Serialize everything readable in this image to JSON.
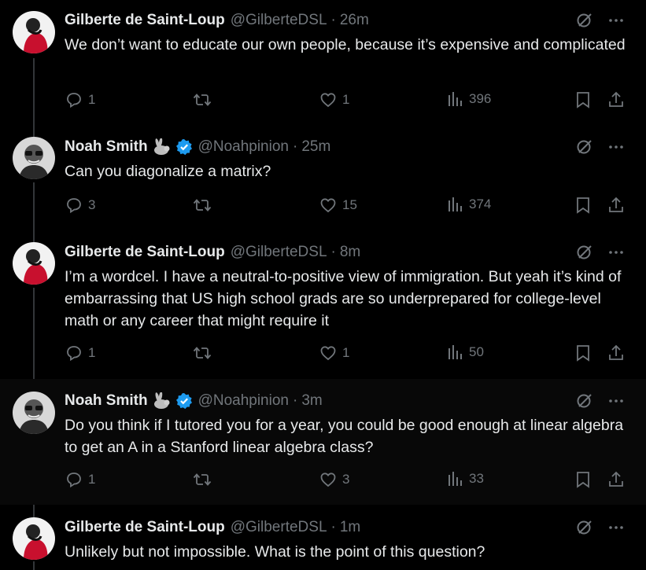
{
  "tweets": [
    {
      "name": "Gilberte de Saint-Loup",
      "handle": "@GilberteDSL",
      "time": "26m",
      "verified": false,
      "emoji": "",
      "text": "We don’t want to educate our own people, because it’s expensive and complicated",
      "replies": "1",
      "retweets": "",
      "likes": "1",
      "views": "396"
    },
    {
      "name": "Noah Smith",
      "handle": "@Noahpinion",
      "time": "25m",
      "verified": true,
      "emoji": "rabbit-emoji",
      "text": "Can you diagonalize a matrix?",
      "replies": "3",
      "retweets": "",
      "likes": "15",
      "views": "374"
    },
    {
      "name": "Gilberte de Saint-Loup",
      "handle": "@GilberteDSL",
      "time": "8m",
      "verified": false,
      "emoji": "",
      "text": "I’m a wordcel. I have a neutral-to-positive view of immigration. But yeah it’s kind of embarrassing that US high school grads are so underprepared for college-level math or any career that might require it",
      "replies": "1",
      "retweets": "",
      "likes": "1",
      "views": "50"
    },
    {
      "name": "Noah Smith",
      "handle": "@Noahpinion",
      "time": "3m",
      "verified": true,
      "emoji": "rabbit-emoji",
      "text": "Do you think if I tutored you for a year, you could be good enough at linear algebra to get an A in a Stanford linear algebra class?",
      "replies": "1",
      "retweets": "",
      "likes": "3",
      "views": "33"
    },
    {
      "name": "Gilberte de Saint-Loup",
      "handle": "@GilberteDSL",
      "time": "1m",
      "verified": false,
      "emoji": "",
      "text": "Unlikely but not impossible. What is the point of this question?",
      "replies": "",
      "retweets": "",
      "likes": "",
      "views": ""
    }
  ],
  "separator": "·",
  "colors": {
    "background": "#000000",
    "text": "#e7e9ea",
    "muted": "#71767b",
    "verified": "#1d9bf0",
    "thread_line": "#333639"
  },
  "icons": [
    "grok-icon",
    "more-icon",
    "reply-icon",
    "retweet-icon",
    "like-icon",
    "views-icon",
    "bookmark-icon",
    "share-icon",
    "verified-icon",
    "rabbit-emoji"
  ]
}
